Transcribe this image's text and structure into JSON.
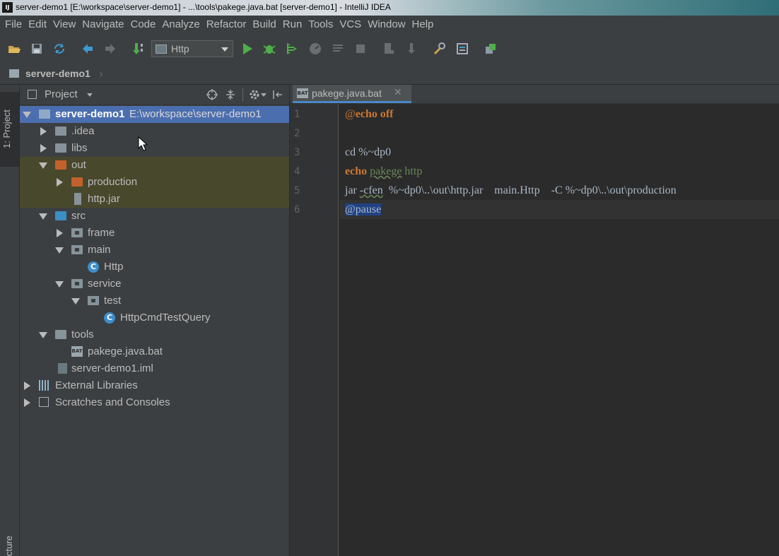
{
  "window": {
    "title": "server-demo1 [E:\\workspace\\server-demo1] - ...\\tools\\pakege.java.bat [server-demo1] - IntelliJ IDEA",
    "app_icon_label": "IJ"
  },
  "menu": [
    "File",
    "Edit",
    "View",
    "Navigate",
    "Code",
    "Analyze",
    "Refactor",
    "Build",
    "Run",
    "Tools",
    "VCS",
    "Window",
    "Help"
  ],
  "toolbar": {
    "run_config": "Http",
    "icons": [
      "open-folder-icon",
      "save-all-icon",
      "sync-icon",
      "back-icon",
      "forward-icon",
      "build-icon",
      "run-icon",
      "debug-icon",
      "coverage-icon",
      "profile-icon",
      "build-artifacts-icon",
      "stop-icon",
      "project-structure-icon",
      "sdk-icon",
      "settings-icon",
      "structure-icon",
      "vcs-icon"
    ]
  },
  "navbar": {
    "project": "server-demo1"
  },
  "stripe": {
    "project_tab": "1: Project",
    "structure_tab": "cture"
  },
  "project_panel": {
    "title": "Project",
    "tree": [
      {
        "label": "server-demo1",
        "path": "E:\\workspace\\server-demo1"
      },
      {
        "label": ".idea"
      },
      {
        "label": "libs"
      },
      {
        "label": "out"
      },
      {
        "label": "production"
      },
      {
        "label": "http.jar"
      },
      {
        "label": "src"
      },
      {
        "label": "frame"
      },
      {
        "label": "main"
      },
      {
        "label": "Http"
      },
      {
        "label": "service"
      },
      {
        "label": "test"
      },
      {
        "label": "HttpCmdTestQuery"
      },
      {
        "label": "tools"
      },
      {
        "label": "pakege.java.bat"
      },
      {
        "label": "server-demo1.iml"
      },
      {
        "label": "External Libraries"
      },
      {
        "label": "Scratches and Consoles"
      }
    ]
  },
  "editor": {
    "tab_label": "pakege.java.bat",
    "tab_icon_label": "BAT",
    "line_numbers": [
      "1",
      "2",
      "3",
      "4",
      "5",
      "6"
    ],
    "lines": {
      "l1_at": "@",
      "l1_kw": "echo off",
      "l3": "cd %~dp0",
      "l4_kw": "echo",
      "l4_str1": "pakege",
      "l4_str2": "http",
      "l5_a": "jar ",
      "l5_b": "-cfen",
      "l5_c": "  %~dp0\\..\\out\\http.jar    main.Http    -C %~dp0\\..\\out\\production",
      "l6": "@pause"
    }
  }
}
